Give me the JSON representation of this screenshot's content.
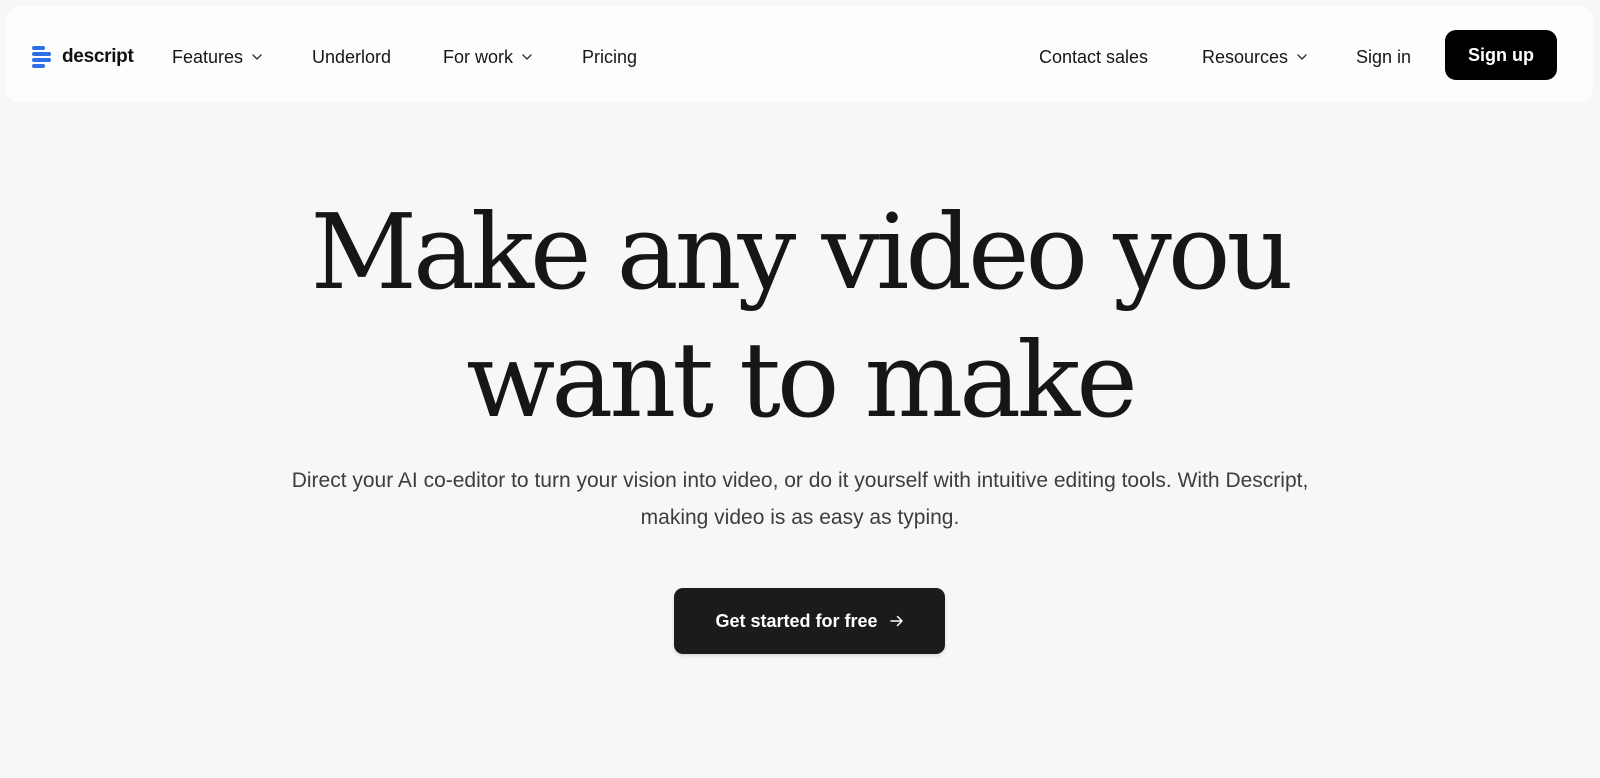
{
  "nav": {
    "logo_text": "descript",
    "logo_icon": "descript-logo-icon",
    "left_items": [
      {
        "label": "Features",
        "has_dropdown": true
      },
      {
        "label": "Underlord",
        "has_dropdown": false
      },
      {
        "label": "For work",
        "has_dropdown": true
      },
      {
        "label": "Pricing",
        "has_dropdown": false
      }
    ],
    "right_items": [
      {
        "label": "Contact sales",
        "has_dropdown": false
      },
      {
        "label": "Resources",
        "has_dropdown": true
      },
      {
        "label": "Sign in",
        "has_dropdown": false
      }
    ],
    "signup_label": "Sign up"
  },
  "hero": {
    "title_line1": "Make any video you",
    "title_line2": "want to make",
    "subtitle": "Direct your AI co-editor to turn your vision into video, or do it yourself with intuitive editing tools. With Descript, making video is as easy as typing.",
    "cta_label": "Get started for free",
    "cta_icon": "arrow-right-icon"
  },
  "colors": {
    "background": "#f8f7f5",
    "navbar": "#fdfdfc",
    "brand_blue": "#2f6fe4",
    "button_dark": "#1b1b1b",
    "signup_black": "#000000"
  }
}
